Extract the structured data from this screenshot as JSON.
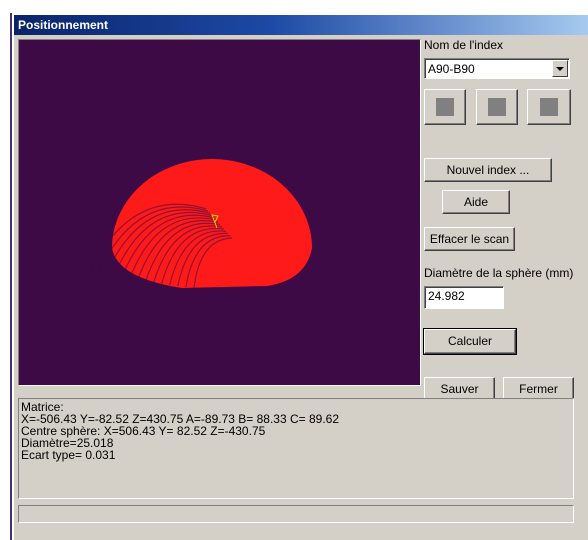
{
  "window": {
    "title": "Positionnement"
  },
  "viewport": {
    "background": "#3d0a45",
    "point_color": "#ff1a1a"
  },
  "index": {
    "label": "Nom de l'index",
    "value": "A90-B90"
  },
  "buttons": {
    "new_index": "Nouvel index ...",
    "help": "Aide",
    "clear_scan": "Effacer le scan",
    "compute": "Calculer",
    "save": "Sauver",
    "close": "Fermer"
  },
  "sphere": {
    "label": "Diamètre de la sphère (mm)",
    "value": "24.982"
  },
  "results": {
    "lines": [
      "Matrice:",
      "X=-506.43 Y=-82.52 Z=430.75 A=-89.73 B= 88.33 C= 89.62",
      "Centre sphère: X=506.43 Y= 82.52 Z=-430.75",
      "Diamètre=25.018",
      "Ecart type= 0.031"
    ]
  },
  "status": {
    "text": ""
  }
}
